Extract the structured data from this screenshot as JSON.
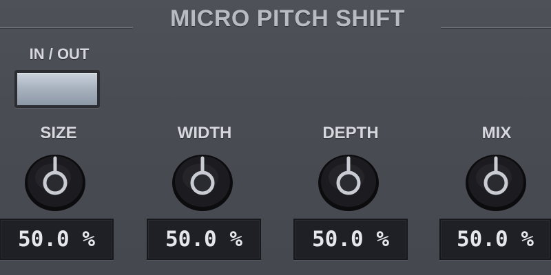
{
  "plugin": {
    "title": "MICRO PITCH SHIFT"
  },
  "bypass": {
    "label": "IN / OUT"
  },
  "controls": [
    {
      "label": "SIZE",
      "value_text": "50.0 %",
      "value_percent": 50.0
    },
    {
      "label": "WIDTH",
      "value_text": "50.0 %",
      "value_percent": 50.0
    },
    {
      "label": "DEPTH",
      "value_text": "50.0 %",
      "value_percent": 50.0
    },
    {
      "label": "MIX",
      "value_text": "50.0 %",
      "value_percent": 50.0
    }
  ],
  "colors": {
    "panel": "#4a4c54",
    "label_text": "#d6d8de",
    "display_bg": "#1f2026",
    "button_face": "#aab4c1"
  },
  "icons": {
    "knob": "rotary-knob-icon"
  }
}
